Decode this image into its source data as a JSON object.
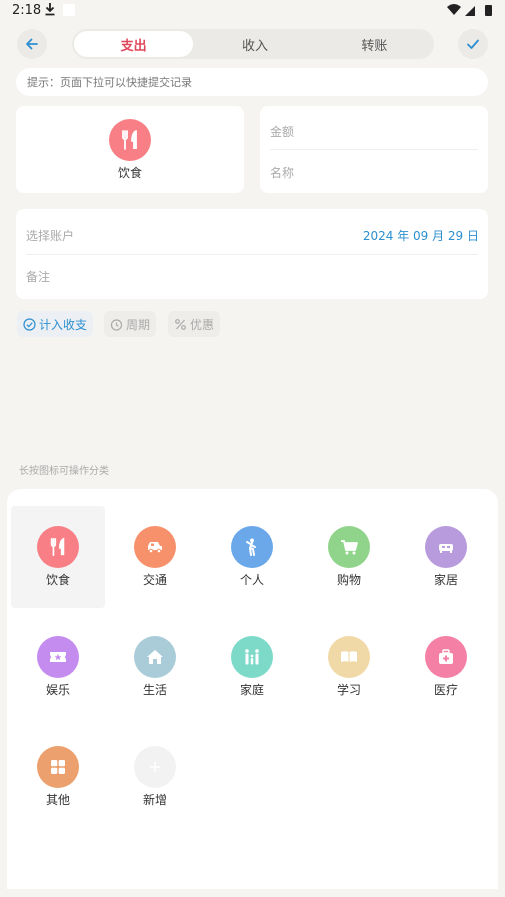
{
  "status_bar": {
    "time": "2:18"
  },
  "header": {
    "tabs": [
      {
        "label": "支出",
        "active": true
      },
      {
        "label": "收入",
        "active": false
      },
      {
        "label": "转账",
        "active": false
      }
    ]
  },
  "hint": "提示：页面下拉可以快捷提交记录",
  "selected_category": {
    "label": "饮食",
    "icon": "fork-knife-icon",
    "color": "#f77f85"
  },
  "form": {
    "amount_placeholder": "金额",
    "name_placeholder": "名称",
    "account_placeholder": "选择账户",
    "date": "2024 年 09 月 29 日",
    "note_placeholder": "备注"
  },
  "chips": [
    {
      "label": "计入收支",
      "active": true
    },
    {
      "label": "周期",
      "active": false
    },
    {
      "label": "优惠",
      "active": false
    }
  ],
  "category_hint": "长按图标可操作分类",
  "categories": [
    {
      "label": "饮食",
      "icon": "fork-knife-icon",
      "color": "#f77f85",
      "selected": true
    },
    {
      "label": "交通",
      "icon": "car-icon",
      "color": "#f7916b"
    },
    {
      "label": "个人",
      "icon": "person-icon",
      "color": "#6aa8ea"
    },
    {
      "label": "购物",
      "icon": "cart-icon",
      "color": "#8fd48a"
    },
    {
      "label": "家居",
      "icon": "sofa-icon",
      "color": "#b79bdd"
    },
    {
      "label": "娱乐",
      "icon": "ticket-icon",
      "color": "#c58cef"
    },
    {
      "label": "生活",
      "icon": "house-icon",
      "color": "#a9ccd8"
    },
    {
      "label": "家庭",
      "icon": "family-icon",
      "color": "#7ddac8"
    },
    {
      "label": "学习",
      "icon": "book-icon",
      "color": "#f0d9a6"
    },
    {
      "label": "医疗",
      "icon": "medical-kit-icon",
      "color": "#f580a5"
    },
    {
      "label": "其他",
      "icon": "grid-icon",
      "color": "#eba06d"
    },
    {
      "label": "新增",
      "icon": "plus-icon",
      "color": "#f2f2f2"
    }
  ]
}
